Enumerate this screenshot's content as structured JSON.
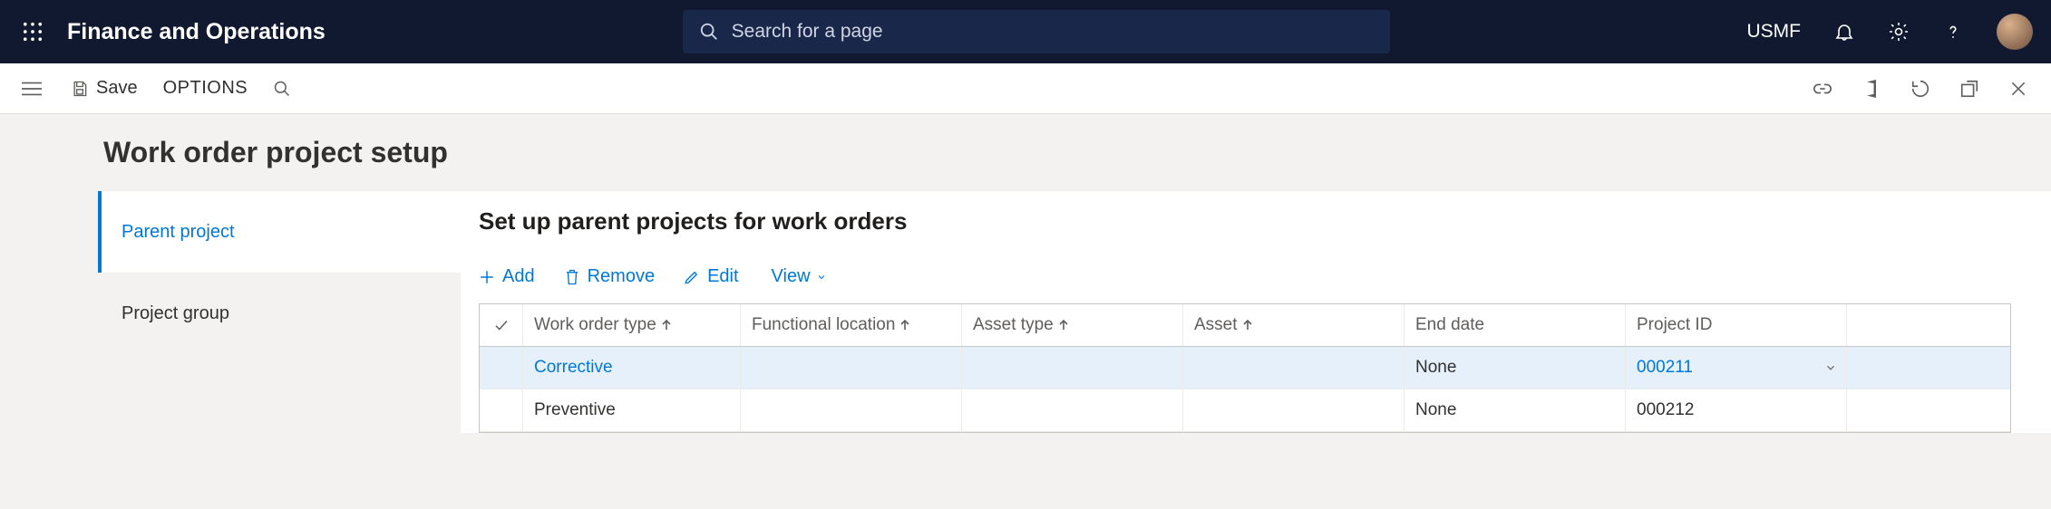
{
  "app_title": "Finance and Operations",
  "search_placeholder": "Search for a page",
  "entity": "USMF",
  "commandbar": {
    "save": "Save",
    "options": "OPTIONS"
  },
  "page": {
    "title": "Work order project setup",
    "tabs": [
      {
        "label": "Parent project"
      },
      {
        "label": "Project group"
      }
    ],
    "panel_title": "Set up parent projects for work orders",
    "actions": {
      "add": "Add",
      "remove": "Remove",
      "edit": "Edit",
      "view": "View"
    },
    "columns": {
      "work_order_type": "Work order type",
      "functional_location": "Functional location",
      "asset_type": "Asset type",
      "asset": "Asset",
      "end_date": "End date",
      "project_id": "Project ID"
    },
    "rows": [
      {
        "work_order_type": "Corrective",
        "functional_location": "",
        "asset_type": "",
        "asset": "",
        "end_date": "None",
        "project_id": "000211",
        "selected": true
      },
      {
        "work_order_type": "Preventive",
        "functional_location": "",
        "asset_type": "",
        "asset": "",
        "end_date": "None",
        "project_id": "000212",
        "selected": false
      }
    ]
  }
}
